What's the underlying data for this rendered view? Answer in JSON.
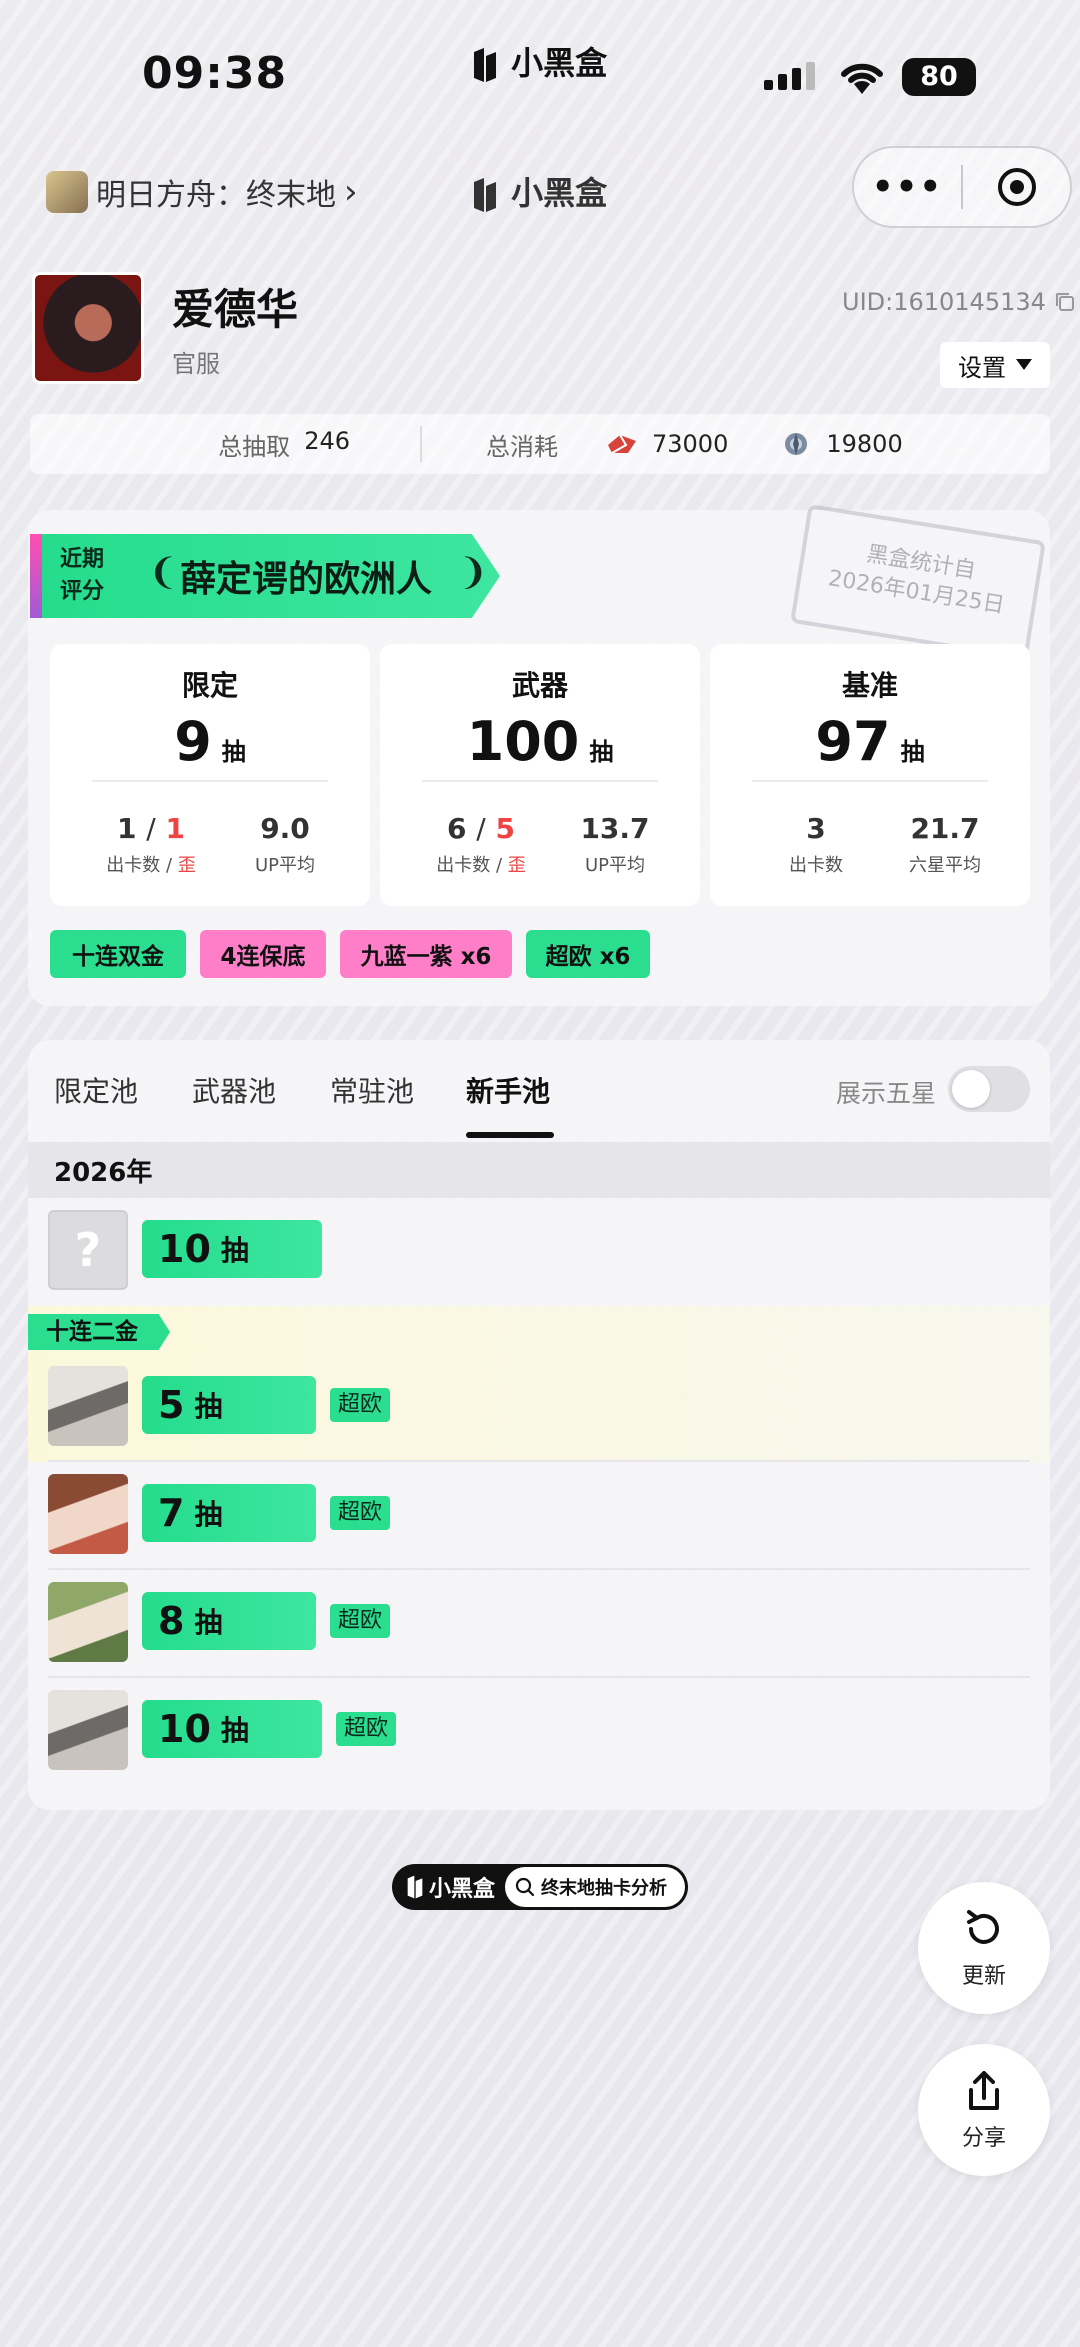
{
  "status_bar": {
    "time": "09:38",
    "brand": "小黑盒",
    "battery": "80"
  },
  "nav": {
    "game_name": "明日方舟：终末地",
    "chevron": "›",
    "brand": "小黑盒",
    "more": "•••"
  },
  "profile": {
    "name": "爱德华",
    "server": "官服",
    "uid": "UID:1610145134",
    "settings_label": "设置"
  },
  "summary": {
    "total_pulls_label": "总抽取",
    "total_pulls_value": "246",
    "total_cost_label": "总消耗",
    "resource1_value": "73000",
    "resource2_value": "19800"
  },
  "rating": {
    "label_line1": "近期",
    "label_line2": "评分",
    "title": "薛定谔的欧洲人",
    "stamp_line1": "黑盒统计自",
    "stamp_line2": "2026年01月25日"
  },
  "pools": [
    {
      "title": "限定",
      "count": "9",
      "unit": "抽",
      "stat1_a": "1",
      "stat1_sep": "/",
      "stat1_b": "1",
      "stat1_label_a": "出卡数 / ",
      "stat1_label_b": "歪",
      "stat2": "9.0",
      "stat2_label": "UP平均"
    },
    {
      "title": "武器",
      "count": "100",
      "unit": "抽",
      "stat1_a": "6",
      "stat1_sep": "/",
      "stat1_b": "5",
      "stat1_label_a": "出卡数 / ",
      "stat1_label_b": "歪",
      "stat2": "13.7",
      "stat2_label": "UP平均"
    },
    {
      "title": "基准",
      "count": "97",
      "unit": "抽",
      "stat1_a": "3",
      "stat1_label_a": "出卡数",
      "stat2": "21.7",
      "stat2_label": "六星平均"
    }
  ],
  "tags": [
    "十连双金",
    "4连保底",
    "九蓝一紫 x6",
    "超欧 x6"
  ],
  "tabs": {
    "items": [
      "限定池",
      "武器池",
      "常驻池",
      "新手池"
    ],
    "active": "新手池",
    "five_star_label": "展示五星",
    "five_star_on": false
  },
  "history": {
    "year": "2026年",
    "unknown_glyph": "?",
    "banner": "十连二金",
    "rows": [
      {
        "count": "10",
        "unit": "抽",
        "badge": ""
      },
      {
        "count": "5",
        "unit": "抽",
        "badge": "超欧"
      },
      {
        "count": "7",
        "unit": "抽",
        "badge": "超欧"
      },
      {
        "count": "8",
        "unit": "抽",
        "badge": "超欧"
      },
      {
        "count": "10",
        "unit": "抽",
        "badge": "超欧"
      }
    ]
  },
  "footer": {
    "brand": "小黑盒",
    "app_name": "终末地抽卡分析"
  },
  "actions": {
    "refresh": "更新",
    "share": "分享"
  },
  "colors": {
    "accent_green": "#2bdd8f",
    "accent_pink": "#ff7ec8",
    "warn_red": "#e44444"
  }
}
